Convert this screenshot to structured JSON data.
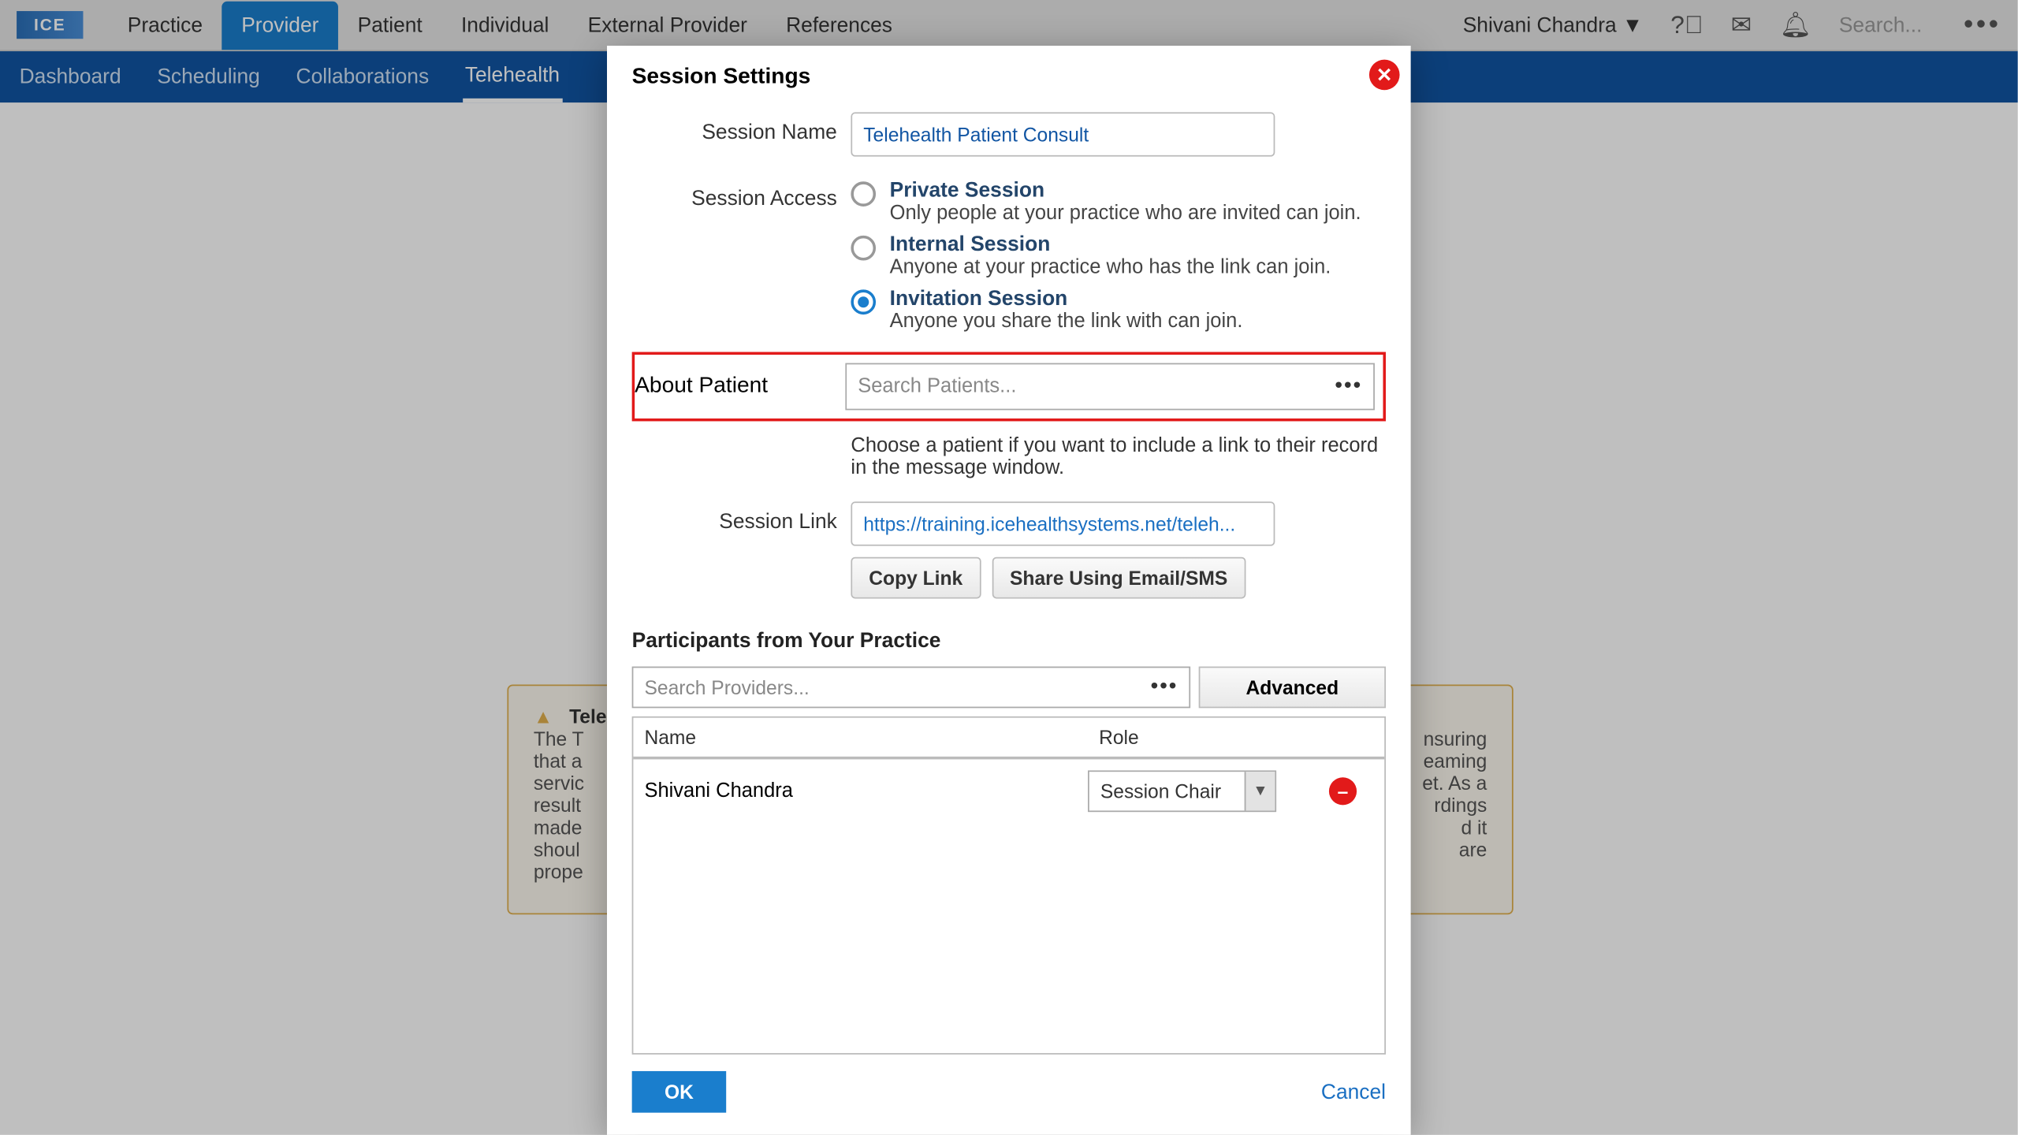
{
  "topbar": {
    "logo_text": "ICE",
    "nav": [
      "Practice",
      "Provider",
      "Patient",
      "Individual",
      "External Provider",
      "References"
    ],
    "active_nav": "Provider",
    "user": "Shivani Chandra",
    "search_placeholder": "Search..."
  },
  "subnav": {
    "items": [
      "Dashboard",
      "Scheduling",
      "Collaborations",
      "Telehealth"
    ],
    "active": "Telehealth"
  },
  "bgcard": {
    "title": "Teleh",
    "body_line1": "The T",
    "body_line2": "that a",
    "body_line3": "servic",
    "body_line4": "result",
    "body_line5": "made",
    "body_line6": "shoul",
    "body_line7": "prope",
    "right1": "nsuring",
    "right2": "eaming",
    "right3": "et. As a",
    "right4": "rdings",
    "right5": "d it",
    "right6": "are"
  },
  "modal": {
    "title": "Session Settings",
    "session_name_label": "Session Name",
    "session_name_value": "Telehealth Patient Consult",
    "session_access_label": "Session Access",
    "access_options": [
      {
        "title": "Private Session",
        "desc": "Only people at your practice who are invited can join.",
        "selected": false
      },
      {
        "title": "Internal Session",
        "desc": "Anyone at your practice who has the link can join.",
        "selected": false
      },
      {
        "title": "Invitation Session",
        "desc": "Anyone you share the link with can join.",
        "selected": true
      }
    ],
    "about_patient_label": "About Patient",
    "about_patient_placeholder": "Search Patients...",
    "about_patient_helper": "Choose a patient if you want to include a link to their record in the message window.",
    "session_link_label": "Session Link",
    "session_link_value": "https://training.icehealthsystems.net/teleh...",
    "copy_link_label": "Copy Link",
    "share_label": "Share Using Email/SMS",
    "participants_title": "Participants from Your Practice",
    "provider_search_placeholder": "Search Providers...",
    "advanced_label": "Advanced",
    "col_name": "Name",
    "col_role": "Role",
    "participants": [
      {
        "name": "Shivani Chandra",
        "role": "Session Chair"
      }
    ],
    "ok_label": "OK",
    "cancel_label": "Cancel"
  }
}
